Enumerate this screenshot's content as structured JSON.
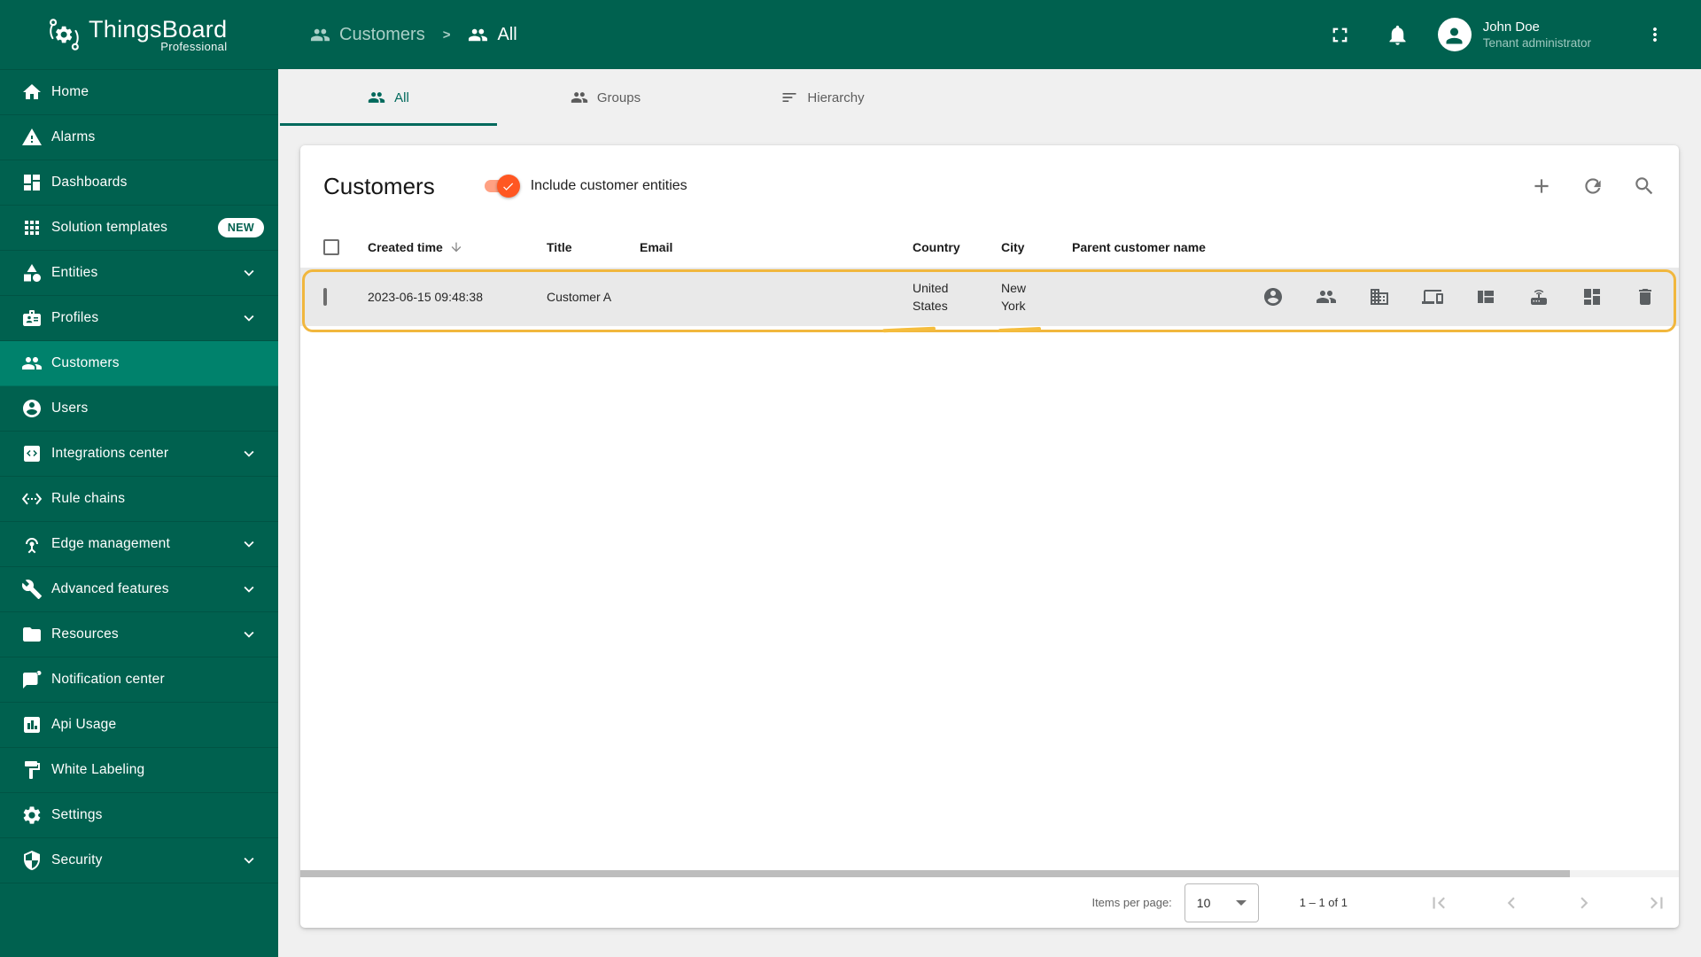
{
  "app": {
    "name": "ThingsBoard",
    "edition": "Professional"
  },
  "colors": {
    "primary": "#00614f",
    "primary_selected": "#00826c",
    "accent_toggle": "#ff5722",
    "annotation": "#f1b73e",
    "content_background": "#f0f0f0",
    "row_background": "#e9e9e9"
  },
  "sidebar": {
    "items": [
      {
        "label": "Home",
        "icon": "home-icon",
        "selected": false,
        "expandable": false,
        "badge": ""
      },
      {
        "label": "Alarms",
        "icon": "alarms-icon",
        "selected": false,
        "expandable": false,
        "badge": ""
      },
      {
        "label": "Dashboards",
        "icon": "dashboards-icon",
        "selected": false,
        "expandable": false,
        "badge": ""
      },
      {
        "label": "Solution templates",
        "icon": "solution-templates-icon",
        "selected": false,
        "expandable": false,
        "badge": "NEW"
      },
      {
        "label": "Entities",
        "icon": "entities-icon",
        "selected": false,
        "expandable": true,
        "badge": ""
      },
      {
        "label": "Profiles",
        "icon": "profiles-icon",
        "selected": false,
        "expandable": true,
        "badge": ""
      },
      {
        "label": "Customers",
        "icon": "customers-icon",
        "selected": true,
        "expandable": false,
        "badge": ""
      },
      {
        "label": "Users",
        "icon": "users-icon",
        "selected": false,
        "expandable": false,
        "badge": ""
      },
      {
        "label": "Integrations center",
        "icon": "integrations-center-icon",
        "selected": false,
        "expandable": true,
        "badge": ""
      },
      {
        "label": "Rule chains",
        "icon": "rule-chains-icon",
        "selected": false,
        "expandable": false,
        "badge": ""
      },
      {
        "label": "Edge management",
        "icon": "edge-management-icon",
        "selected": false,
        "expandable": true,
        "badge": ""
      },
      {
        "label": "Advanced features",
        "icon": "advanced-features-icon",
        "selected": false,
        "expandable": true,
        "badge": ""
      },
      {
        "label": "Resources",
        "icon": "resources-icon",
        "selected": false,
        "expandable": true,
        "badge": ""
      },
      {
        "label": "Notification center",
        "icon": "notification-center-icon",
        "selected": false,
        "expandable": false,
        "badge": ""
      },
      {
        "label": "Api Usage",
        "icon": "api-usage-icon",
        "selected": false,
        "expandable": false,
        "badge": ""
      },
      {
        "label": "White Labeling",
        "icon": "white-labeling-icon",
        "selected": false,
        "expandable": false,
        "badge": ""
      },
      {
        "label": "Settings",
        "icon": "settings-icon",
        "selected": false,
        "expandable": false,
        "badge": ""
      },
      {
        "label": "Security",
        "icon": "security-icon",
        "selected": false,
        "expandable": true,
        "badge": ""
      }
    ]
  },
  "header": {
    "breadcrumb": [
      {
        "label": "Customers",
        "icon": "customers-group-icon"
      },
      {
        "label": "All",
        "icon": "customers-group-icon"
      }
    ],
    "separator": ">",
    "user": {
      "name": "John Doe",
      "role": "Tenant administrator"
    }
  },
  "tabs": [
    {
      "label": "All",
      "icon": "group-icon",
      "active": true
    },
    {
      "label": "Groups",
      "icon": "group-icon",
      "active": false
    },
    {
      "label": "Hierarchy",
      "icon": "hierarchy-icon",
      "active": false
    }
  ],
  "panel": {
    "title": "Customers",
    "toggle": {
      "label": "Include customer entities",
      "on": true
    },
    "actions": [
      {
        "name": "add-customer",
        "icon": "plus-icon"
      },
      {
        "name": "refresh",
        "icon": "refresh-icon"
      },
      {
        "name": "search",
        "icon": "search-icon"
      }
    ]
  },
  "table": {
    "columns": [
      {
        "label": "Created time",
        "sorted": "desc"
      },
      {
        "label": "Title",
        "sorted": ""
      },
      {
        "label": "Email",
        "sorted": ""
      },
      {
        "label": "Country",
        "sorted": ""
      },
      {
        "label": "City",
        "sorted": ""
      },
      {
        "label": "Parent customer name",
        "sorted": ""
      }
    ],
    "rows": [
      {
        "created_time": "2023-06-15 09:48:38",
        "title": "Customer A",
        "email": "",
        "country": "United States",
        "city": "New York",
        "parent_customer_name": "",
        "selected": false,
        "highlighted": true
      }
    ],
    "row_actions": [
      {
        "name": "manage-customer-users",
        "icon": "account-circle-icon"
      },
      {
        "name": "manage-customers",
        "icon": "people-icon"
      },
      {
        "name": "manage-customer-assets",
        "icon": "building-icon"
      },
      {
        "name": "manage-customer-devices",
        "icon": "devices-icon"
      },
      {
        "name": "manage-customer-entity-views",
        "icon": "view-quilt-icon"
      },
      {
        "name": "manage-customer-edge-instances",
        "icon": "router-icon"
      },
      {
        "name": "manage-customer-dashboards",
        "icon": "dashboards-grid-icon"
      },
      {
        "name": "delete-customer",
        "icon": "trash-icon"
      }
    ]
  },
  "pagination": {
    "items_per_page_label": "Items per page:",
    "items_per_page": "10",
    "range": "1 – 1 of 1",
    "controls": [
      {
        "name": "first-page",
        "icon": "first-page-icon",
        "disabled": true
      },
      {
        "name": "previous-page",
        "icon": "chevron-left-icon",
        "disabled": true
      },
      {
        "name": "next-page",
        "icon": "chevron-right-icon",
        "disabled": true
      },
      {
        "name": "last-page",
        "icon": "last-page-icon",
        "disabled": true
      }
    ]
  }
}
